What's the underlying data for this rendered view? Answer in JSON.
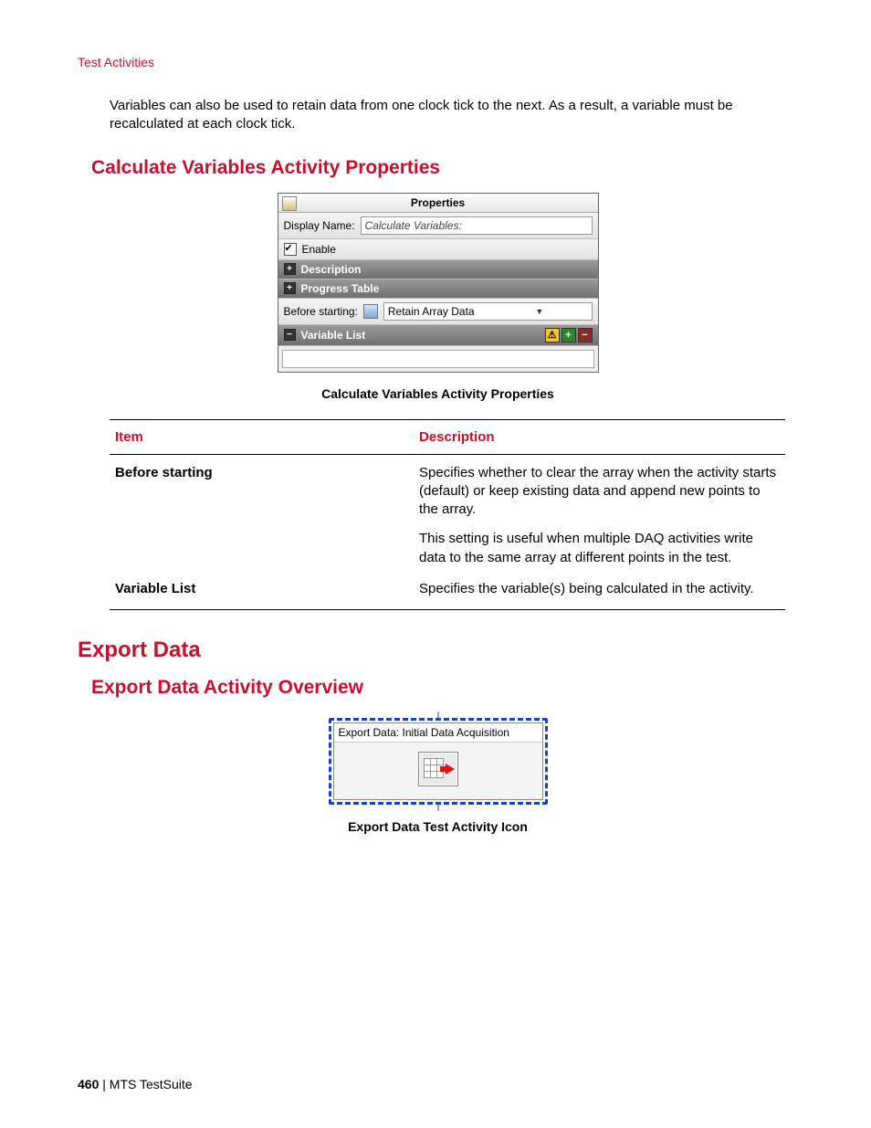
{
  "header": {
    "breadcrumb": "Test Activities"
  },
  "intro_para": "Variables can also be used to retain data from one clock tick to the next. As a result, a variable must be recalculated at each clock tick.",
  "section1": {
    "heading": "Calculate Variables Activity Properties",
    "panel": {
      "title": "Properties",
      "display_name_label": "Display Name:",
      "display_name_value": "Calculate Variables:",
      "enable_label": "Enable",
      "description_label": "Description",
      "progress_table_label": "Progress Table",
      "before_starting_label": "Before starting:",
      "before_starting_value": "Retain Array Data",
      "variable_list_label": "Variable List"
    },
    "caption": "Calculate Variables Activity Properties",
    "table": {
      "headers": [
        "Item",
        "Description"
      ],
      "rows": [
        {
          "item": "Before starting",
          "desc": [
            "Specifies whether to clear the array when the activity starts (default) or keep existing data and append new points to the array.",
            "This setting is useful when multiple DAQ activities write data to the same array at different points in the test."
          ]
        },
        {
          "item": "Variable List",
          "desc": [
            "Specifies the variable(s) being calculated in the activity."
          ]
        }
      ]
    }
  },
  "section2": {
    "heading": "Export Data",
    "subheading": "Export Data Activity Overview",
    "icon_label": "Export Data: Initial Data Acquisition",
    "caption": "Export Data Test Activity Icon"
  },
  "footer": {
    "page": "460",
    "product": "MTS TestSuite"
  }
}
